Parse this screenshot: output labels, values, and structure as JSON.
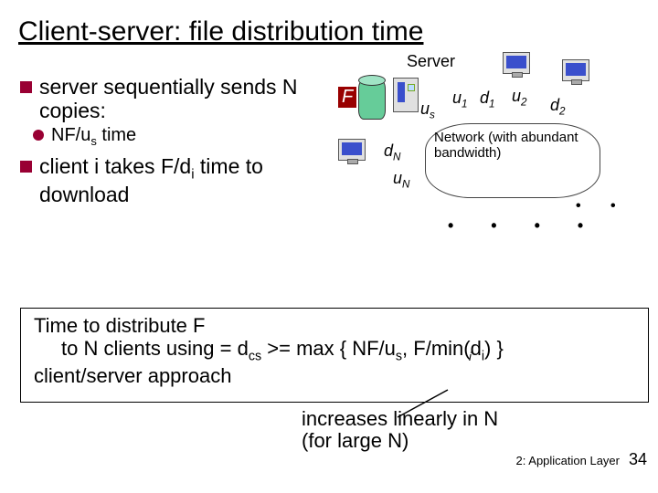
{
  "title": "Client-server: file distribution time",
  "bullets": {
    "b1_pre": "server sequentially sends N copies:",
    "b1_sub_pre": "NF/u",
    "b1_sub_s": "s",
    "b1_sub_post": " time",
    "b2_pre": "client i takes F/d",
    "b2_i": "i",
    "b2_post": " time to download"
  },
  "diagram": {
    "server_label": "Server",
    "F": "F",
    "us": "u",
    "us_sub": "s",
    "u1": "u",
    "u1_sub": "1",
    "d1": "d",
    "d1_sub": "1",
    "u2": "u",
    "u2_sub": "2",
    "d2": "d",
    "d2_sub": "2",
    "dN": "d",
    "dN_sub": "N",
    "uN": "u",
    "uN_sub": "N",
    "cloud_text": "Network (with abundant bandwidth)"
  },
  "formula": {
    "line1": "Time to  distribute F",
    "line2_left": "to N clients using",
    "line3": "client/server approach",
    "eq_dcs_pre": " = d",
    "eq_dcs_sub": "cs",
    "eq_mid": " >= max { NF/u",
    "eq_us_sub": "s",
    "eq_sep": ", F/min(d",
    "eq_di_sub": "i",
    "eq_close": ") }",
    "min_over": "i"
  },
  "note": {
    "l1": "increases linearly in N",
    "l2": "(for large N)"
  },
  "footer": {
    "chapter": "2: Application Layer",
    "page": "34"
  }
}
